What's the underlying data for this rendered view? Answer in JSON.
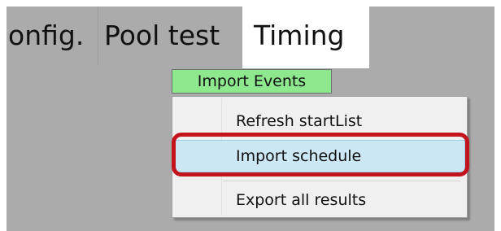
{
  "tabs": [
    {
      "label": "onfig."
    },
    {
      "label": "Pool test"
    },
    {
      "label": "Timing"
    }
  ],
  "toolbar": {
    "import_events_label": "Import Events"
  },
  "menu": {
    "items": [
      {
        "label": "Refresh startList"
      },
      {
        "label": "Import schedule"
      },
      {
        "label": "Export all results"
      }
    ]
  },
  "colors": {
    "button_bg": "#8ee98e",
    "highlight": "#c3141e",
    "hover_item": "#cce8f4",
    "panel": "#ababab"
  },
  "icons": [
    "highlight-annotation"
  ]
}
